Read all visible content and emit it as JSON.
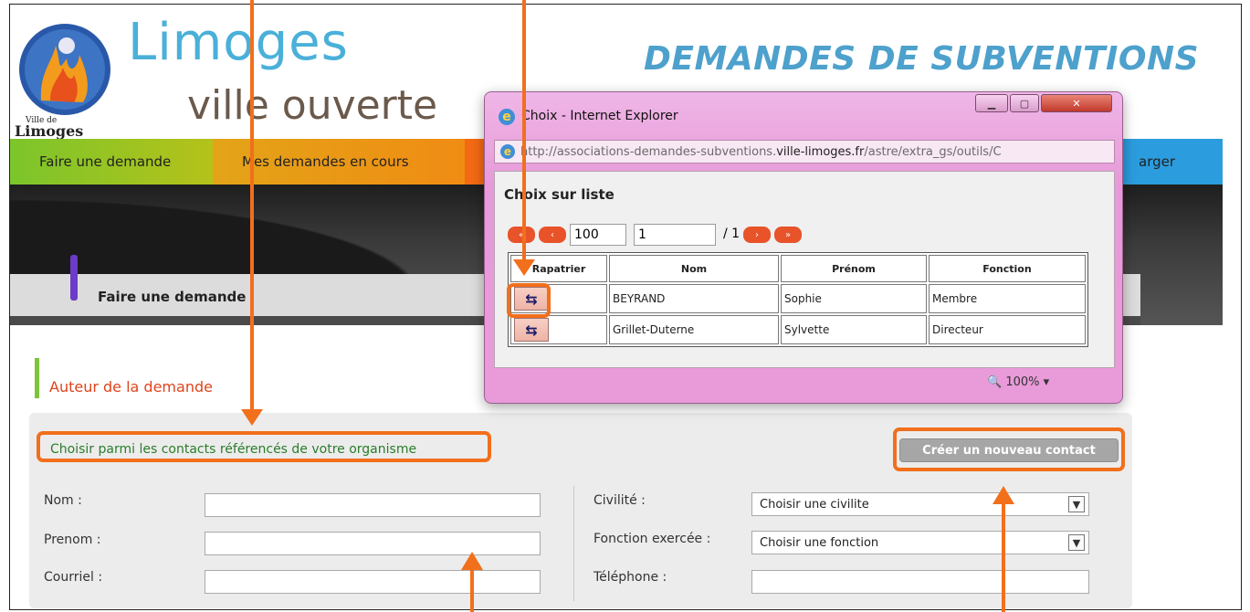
{
  "header": {
    "logo_title": "Limoges",
    "logo_subtitle": "ville ouverte",
    "logo_small_top": "Ville de",
    "logo_small_bottom": "Limoges",
    "site_title": "DEMANDES DE SUBVENTIONS"
  },
  "nav": {
    "items": [
      "Faire une demande",
      "Mes demandes en cours",
      "",
      "arger"
    ]
  },
  "breadcrumb": "Faire une demande",
  "section": {
    "title": "Auteur de la demande",
    "choose_link": "Choisir parmi les contacts référencés de votre organisme",
    "create_button": "Créer un nouveau contact"
  },
  "form": {
    "left": [
      {
        "label": "Nom :",
        "value": ""
      },
      {
        "label": "Prenom :",
        "value": ""
      },
      {
        "label": "Courriel :",
        "value": ""
      }
    ],
    "right": [
      {
        "label": "Civilité :",
        "value": "Choisir une civilite"
      },
      {
        "label": "Fonction exercée :",
        "value": "Choisir une fonction"
      },
      {
        "label": "Téléphone :",
        "value": ""
      }
    ]
  },
  "popup": {
    "window_title": "Choix - Internet Explorer",
    "url_prefix": "http://associations-demandes-subventions.",
    "url_domain": "ville-limoges.fr",
    "url_suffix": "/astre/extra_gs/outils/C",
    "heading": "Choix sur liste",
    "page_size": "100",
    "page_number": "1",
    "page_total": "/ 1",
    "columns": [
      "Rapatrier",
      "Nom",
      "Prénom",
      "Fonction"
    ],
    "rows": [
      {
        "nom": "BEYRAND",
        "prenom": "Sophie",
        "fonction": "Membre"
      },
      {
        "nom": "Grillet-Duterne",
        "prenom": "Sylvette",
        "fonction": "Directeur"
      }
    ],
    "zoom": "100%"
  },
  "colors": {
    "annotation": "#f26f1c",
    "accent_red": "#e0441c",
    "link_green": "#2a7d2a",
    "title_blue": "#4da1cc"
  }
}
